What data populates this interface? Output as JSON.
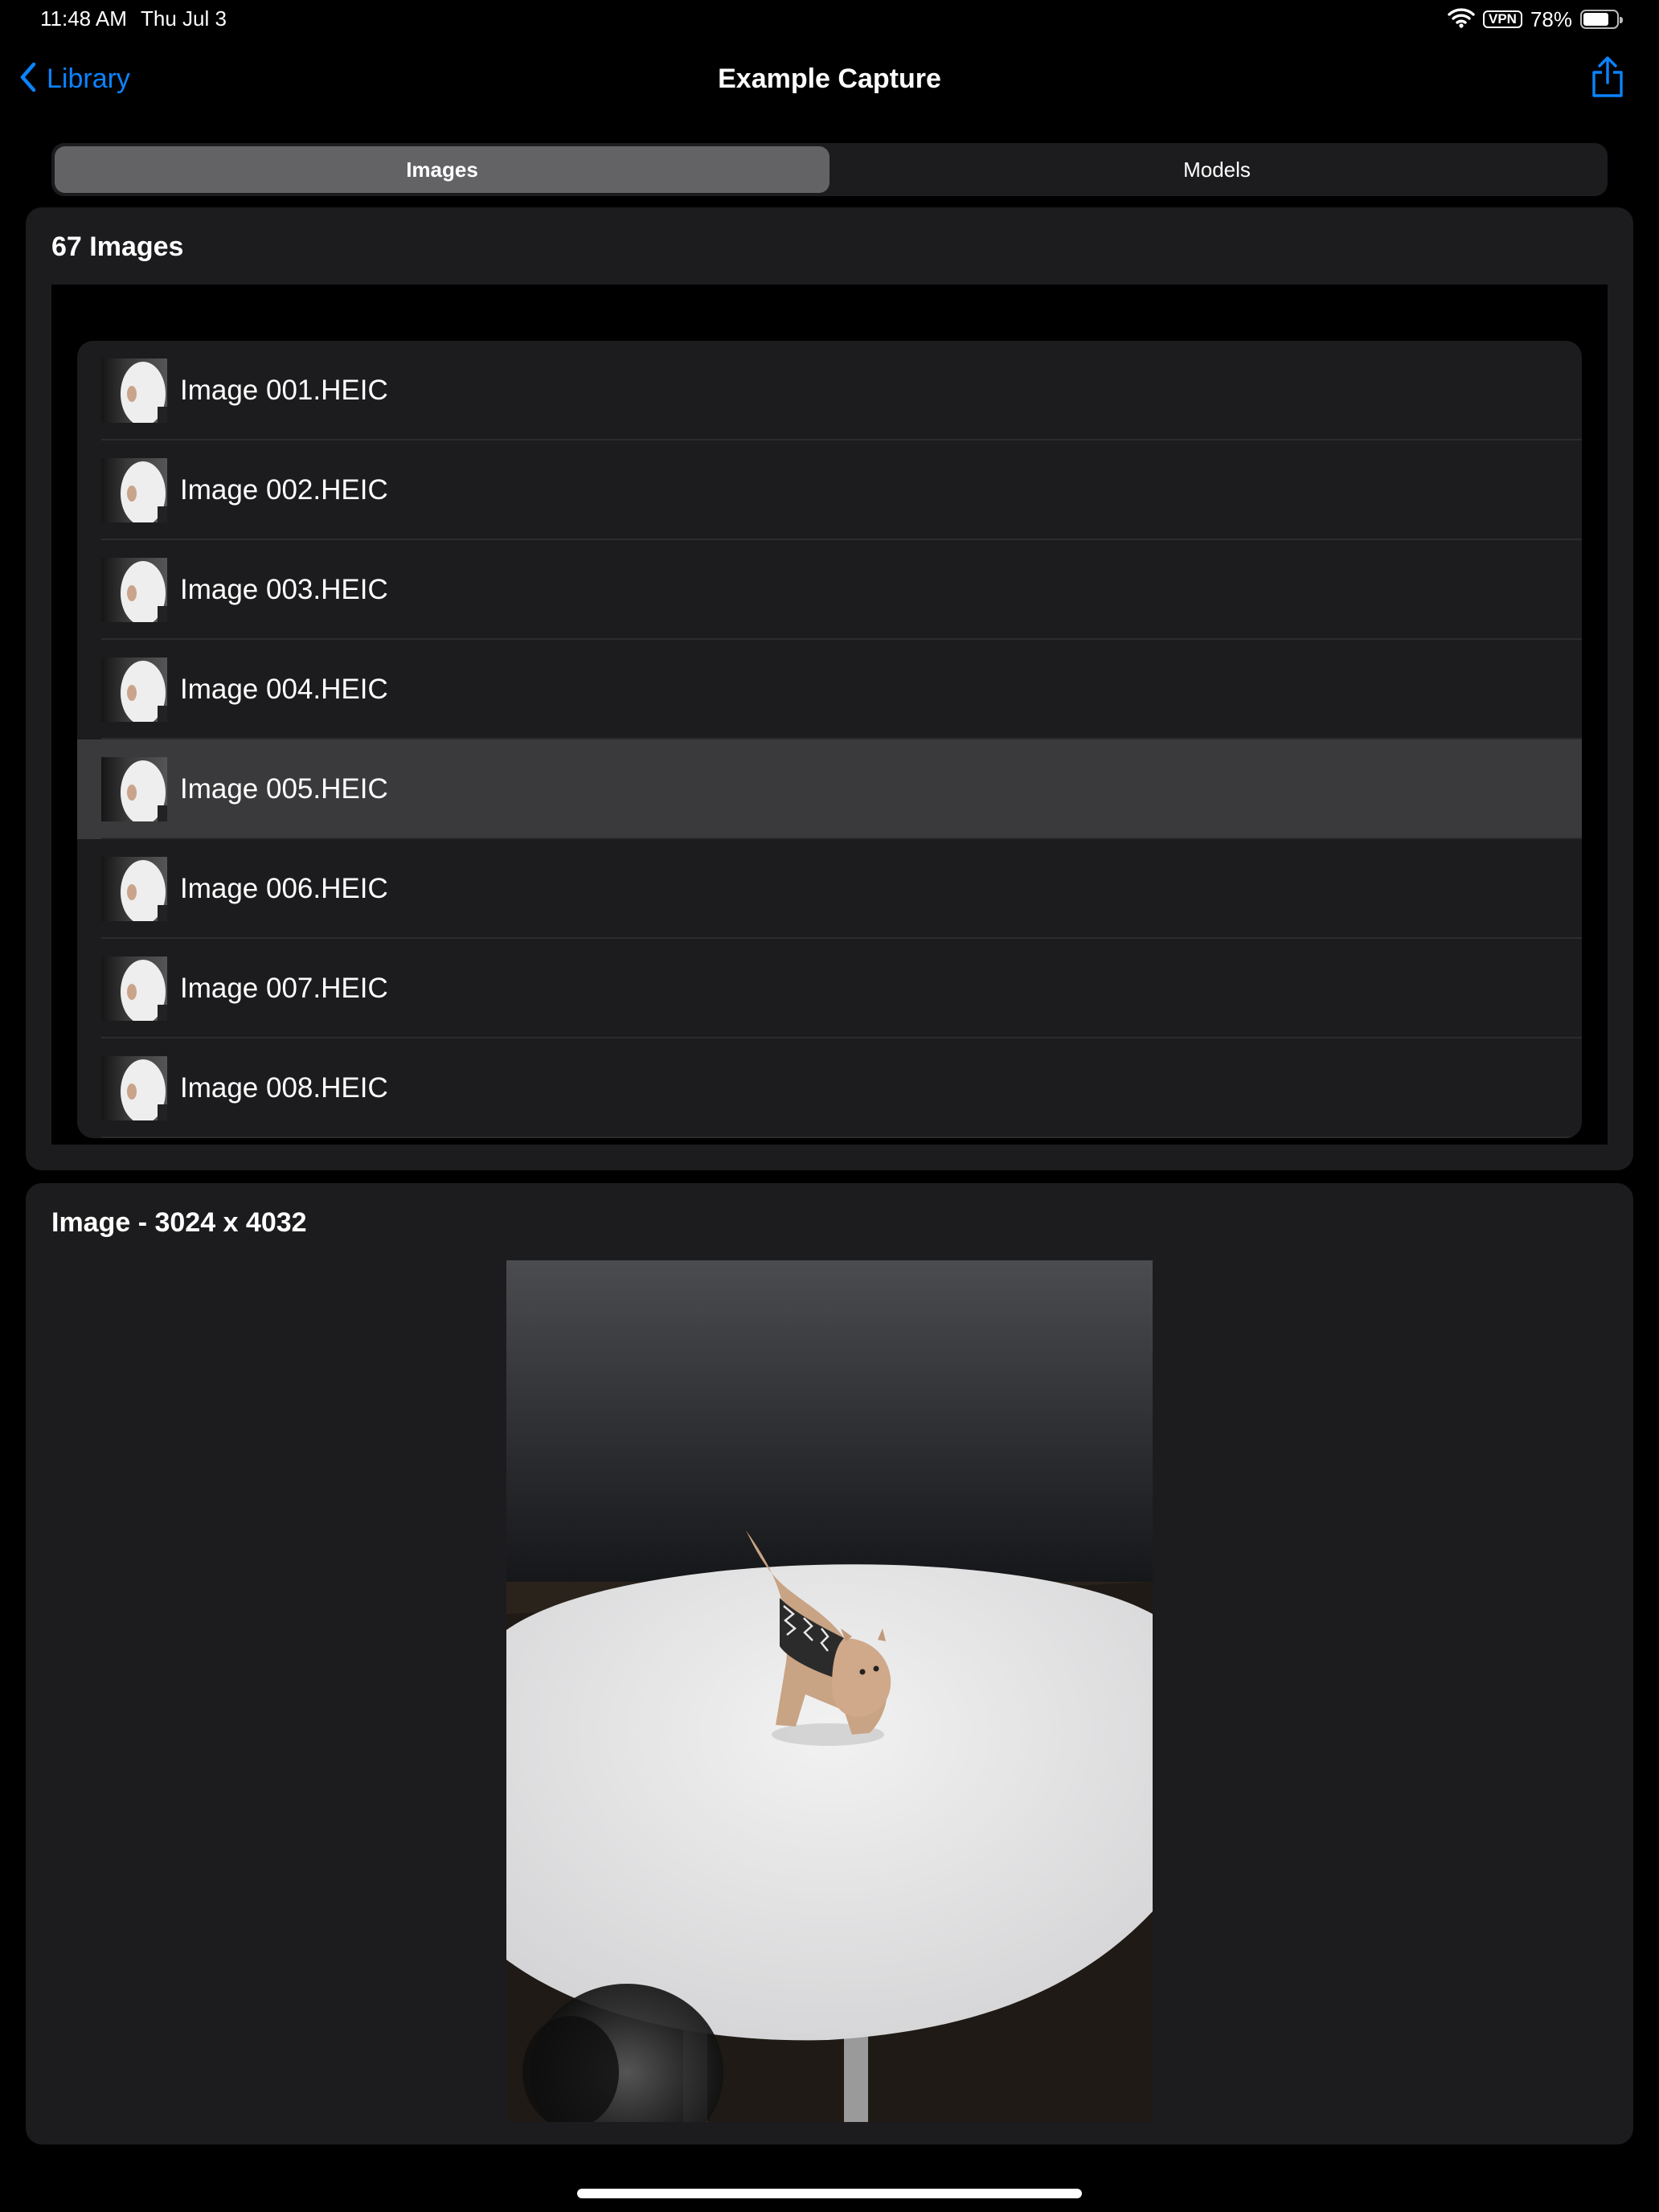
{
  "status_bar": {
    "time": "11:48 AM",
    "date": "Thu Jul 3",
    "vpn": "VPN",
    "battery_percent": "78%",
    "battery_level": 0.78
  },
  "nav": {
    "back_label": "Library",
    "title": "Example Capture",
    "share_icon": "share-icon"
  },
  "segments": [
    {
      "label": "Images",
      "selected": true
    },
    {
      "label": "Models",
      "selected": false
    }
  ],
  "images_panel": {
    "heading": "67 Images",
    "items": [
      {
        "label": "Image 001.HEIC",
        "selected": false
      },
      {
        "label": "Image 002.HEIC",
        "selected": false
      },
      {
        "label": "Image 003.HEIC",
        "selected": false
      },
      {
        "label": "Image 004.HEIC",
        "selected": false
      },
      {
        "label": "Image 005.HEIC",
        "selected": true
      },
      {
        "label": "Image 006.HEIC",
        "selected": false
      },
      {
        "label": "Image 007.HEIC",
        "selected": false
      },
      {
        "label": "Image 008.HEIC",
        "selected": false
      }
    ]
  },
  "preview_panel": {
    "heading": "Image - 3024 x 4032"
  },
  "colors": {
    "accent": "#0a84ff",
    "background": "#000000",
    "panel": "#1c1c1e",
    "selected_row": "#3a3a3c"
  }
}
